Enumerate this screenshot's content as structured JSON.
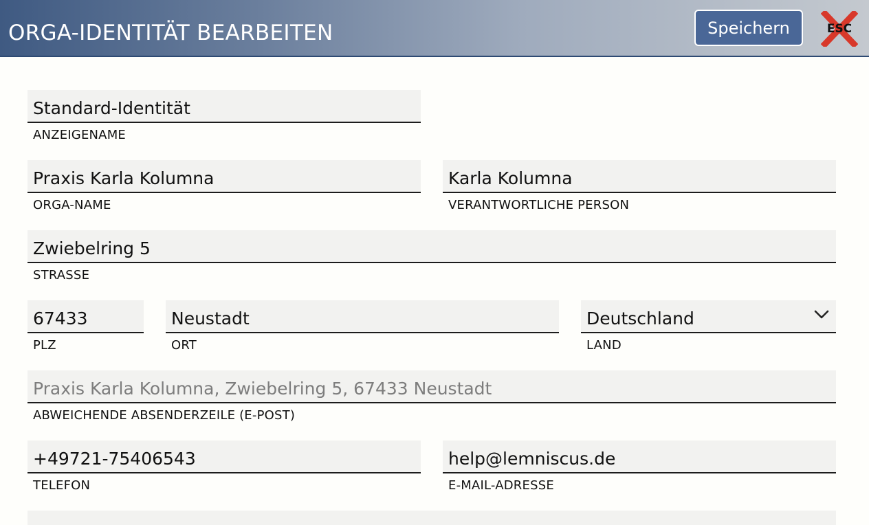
{
  "header": {
    "title": "ORGA-IDENTITÄT BEARBEITEN",
    "save_label": "Speichern",
    "esc_label": "ESC"
  },
  "form": {
    "display_name": {
      "value": "Standard-Identität",
      "label": "ANZEIGENAME"
    },
    "orga_name": {
      "value": "Praxis Karla Kolumna",
      "label": "ORGA-NAME"
    },
    "responsible_person": {
      "value": "Karla Kolumna",
      "label": "VERANTWORTLICHE PERSON"
    },
    "street": {
      "value": "Zwiebelring 5",
      "label": "STRASSE"
    },
    "zip": {
      "value": "67433",
      "label": "PLZ"
    },
    "city": {
      "value": "Neustadt",
      "label": "ORT"
    },
    "country": {
      "value": "Deutschland",
      "label": "LAND"
    },
    "sender_line": {
      "placeholder": "Praxis Karla Kolumna, Zwiebelring 5, 67433 Neustadt",
      "label": "ABWEICHENDE ABSENDERZEILE (E-POST)"
    },
    "phone": {
      "value": "+49721-75406543",
      "label": "TELEFON"
    },
    "email": {
      "value": "help@lemniscus.de",
      "label": "E-MAIL-ADRESSE"
    }
  },
  "colors": {
    "accent": "#4a6797",
    "header_start": "#3f5a82",
    "header_end": "#c4c9cf",
    "esc_cross": "#d8382a",
    "field_bg": "#f2f2f0"
  },
  "icons": {
    "esc": "close-cross-icon",
    "country_dropdown": "chevron-down-icon"
  }
}
